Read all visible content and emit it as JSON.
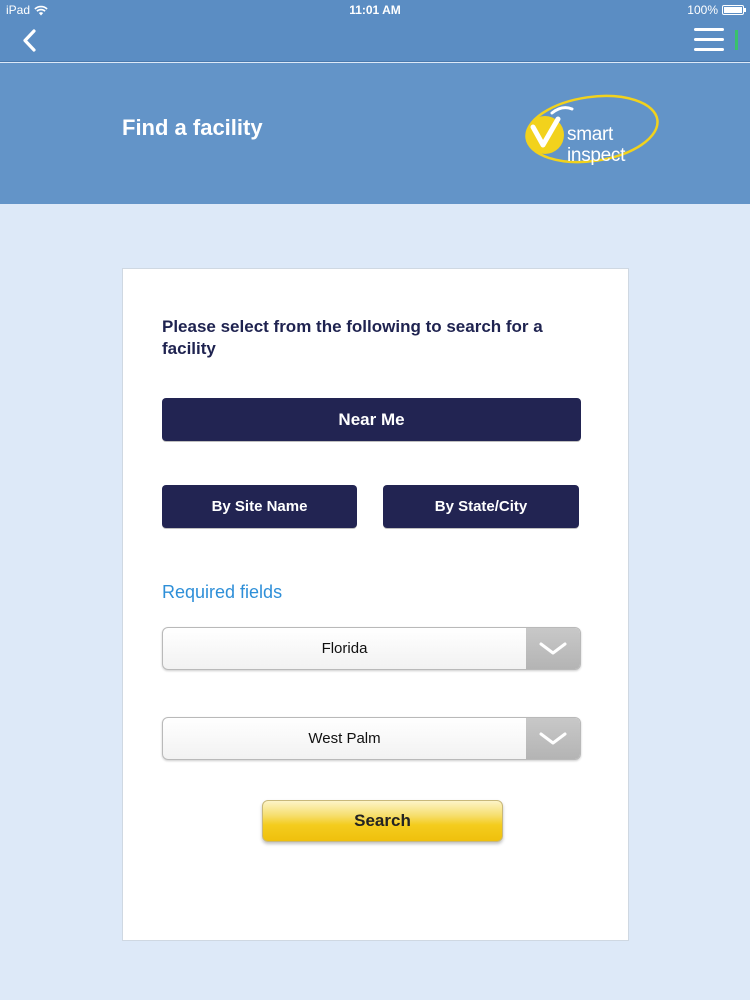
{
  "status_bar": {
    "carrier": "iPad",
    "time": "11:01 AM",
    "battery": "100%"
  },
  "nav": {
    "back_icon": "chevron-left-icon",
    "menu_icon": "hamburger-menu-icon"
  },
  "header": {
    "title": "Find a facility",
    "logo_line1": "smart",
    "logo_line2": "inspect"
  },
  "form": {
    "instructions": "Please select from the following to search for a facility",
    "near_me_label": "Near Me",
    "by_site_name_label": "By Site Name",
    "by_state_city_label": "By State/City",
    "required_fields_label": "Required fields",
    "state_value": "Florida",
    "city_value": "West Palm",
    "search_label": "Search"
  },
  "colors": {
    "nav_blue": "#5b8dc3",
    "header_blue": "#6394c8",
    "page_bg": "#dde9f8",
    "button_navy": "#222452",
    "link_blue": "#2e8fd8",
    "search_yellow": "#f4cc1e",
    "logo_yellow": "#f2d21c"
  }
}
